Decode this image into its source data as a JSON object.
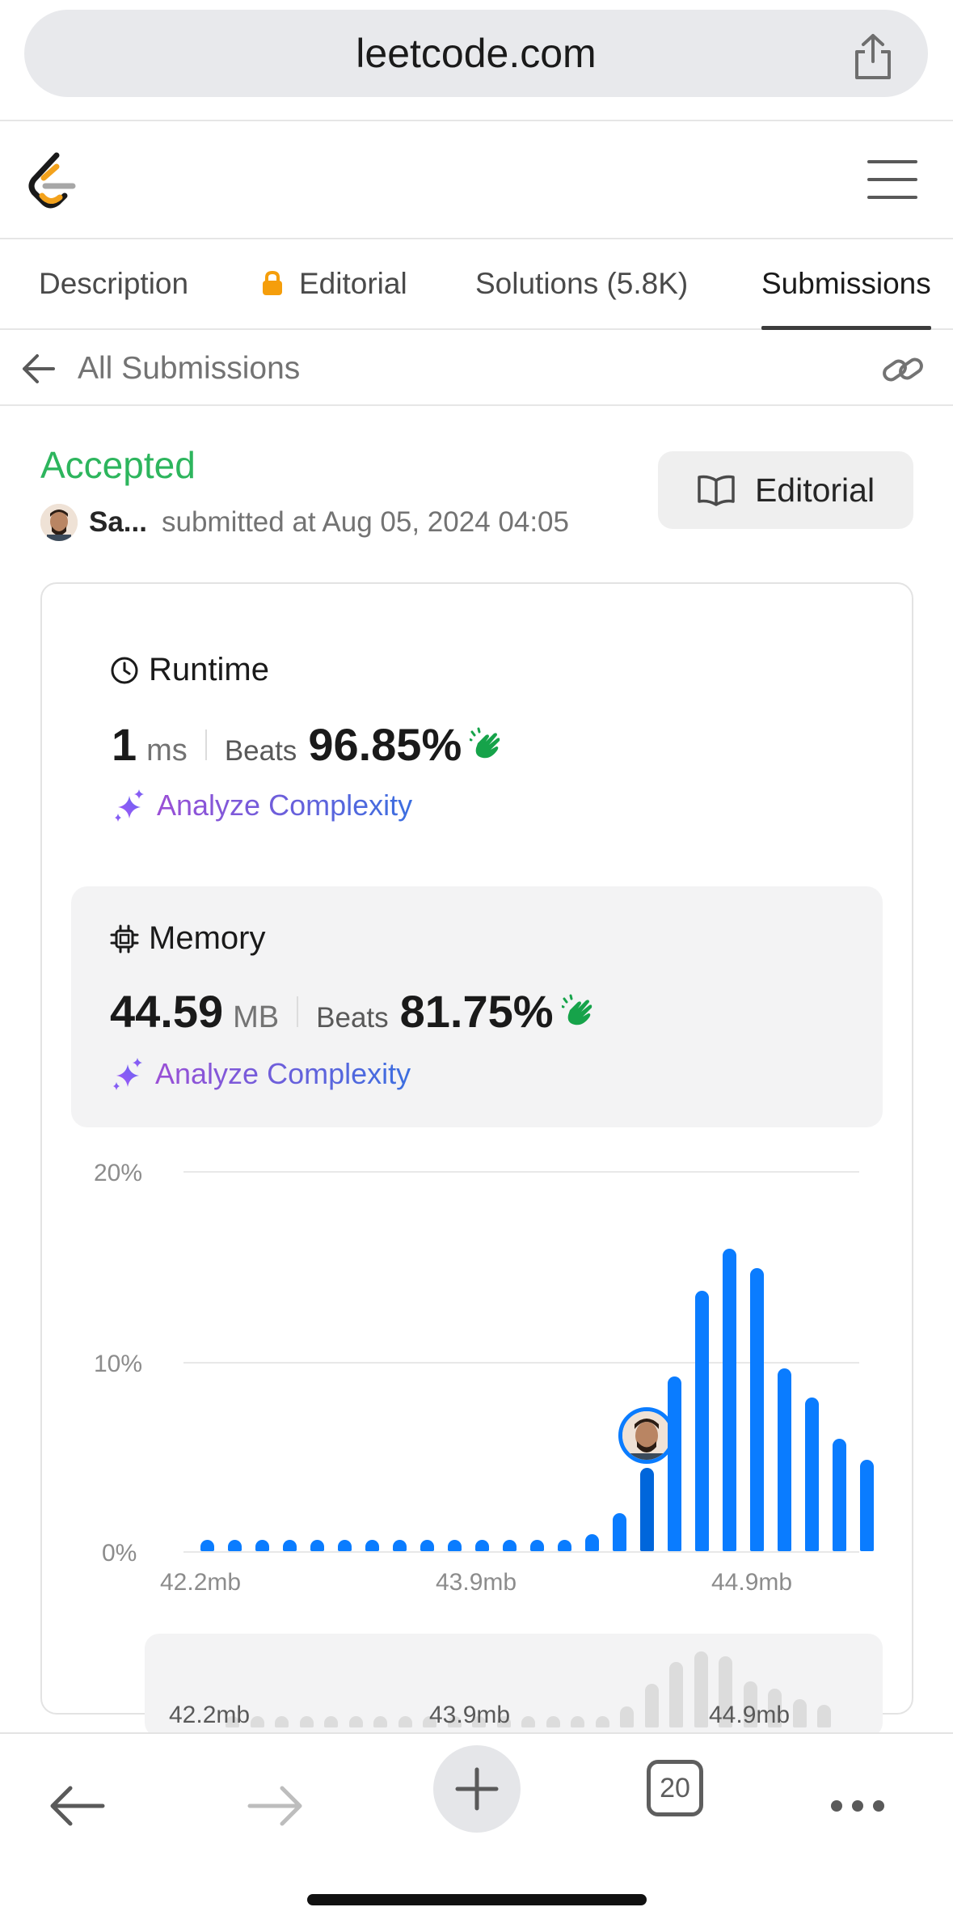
{
  "browser": {
    "url": "leetcode.com",
    "tab_count": "20"
  },
  "tabs": [
    {
      "label": "Description"
    },
    {
      "label": "Editorial",
      "locked": true
    },
    {
      "label": "Solutions (5.8K)"
    },
    {
      "label": "Submissions",
      "active": true
    }
  ],
  "nav": {
    "back_label": "All Submissions"
  },
  "submission": {
    "status": "Accepted",
    "status_color": "#2db55d",
    "user": "Sa...",
    "submitted_text": "submitted at Aug 05, 2024 04:05",
    "editorial_button": "Editorial"
  },
  "runtime": {
    "title": "Runtime",
    "value": "1",
    "unit": "ms",
    "beats_label": "Beats",
    "beats_pct": "96.85%",
    "analyze": "Analyze Complexity"
  },
  "memory": {
    "title": "Memory",
    "value": "44.59",
    "unit": "MB",
    "beats_label": "Beats",
    "beats_pct": "81.75%",
    "analyze": "Analyze Complexity"
  },
  "chart_data": {
    "type": "bar",
    "ylabel": "",
    "xlabel": "",
    "yticks": [
      "20%",
      "10%",
      "0%"
    ],
    "ylim": [
      0,
      20
    ],
    "xticks": [
      "42.2mb",
      "43.9mb",
      "44.9mb"
    ],
    "accent_color": "#0a7cff",
    "highlight_index": 16,
    "values": [
      0.6,
      0.6,
      0.6,
      0.6,
      0.6,
      0.6,
      0.6,
      0.6,
      0.6,
      0.6,
      0.6,
      0.6,
      0.6,
      0.6,
      0.9,
      2.0,
      4.4,
      9.2,
      13.7,
      15.9,
      14.9,
      9.6,
      8.1,
      5.9,
      4.8
    ],
    "grid": true
  },
  "mini_chart": {
    "labels": [
      "42.2mb",
      "43.9mb",
      "44.9mb"
    ]
  }
}
